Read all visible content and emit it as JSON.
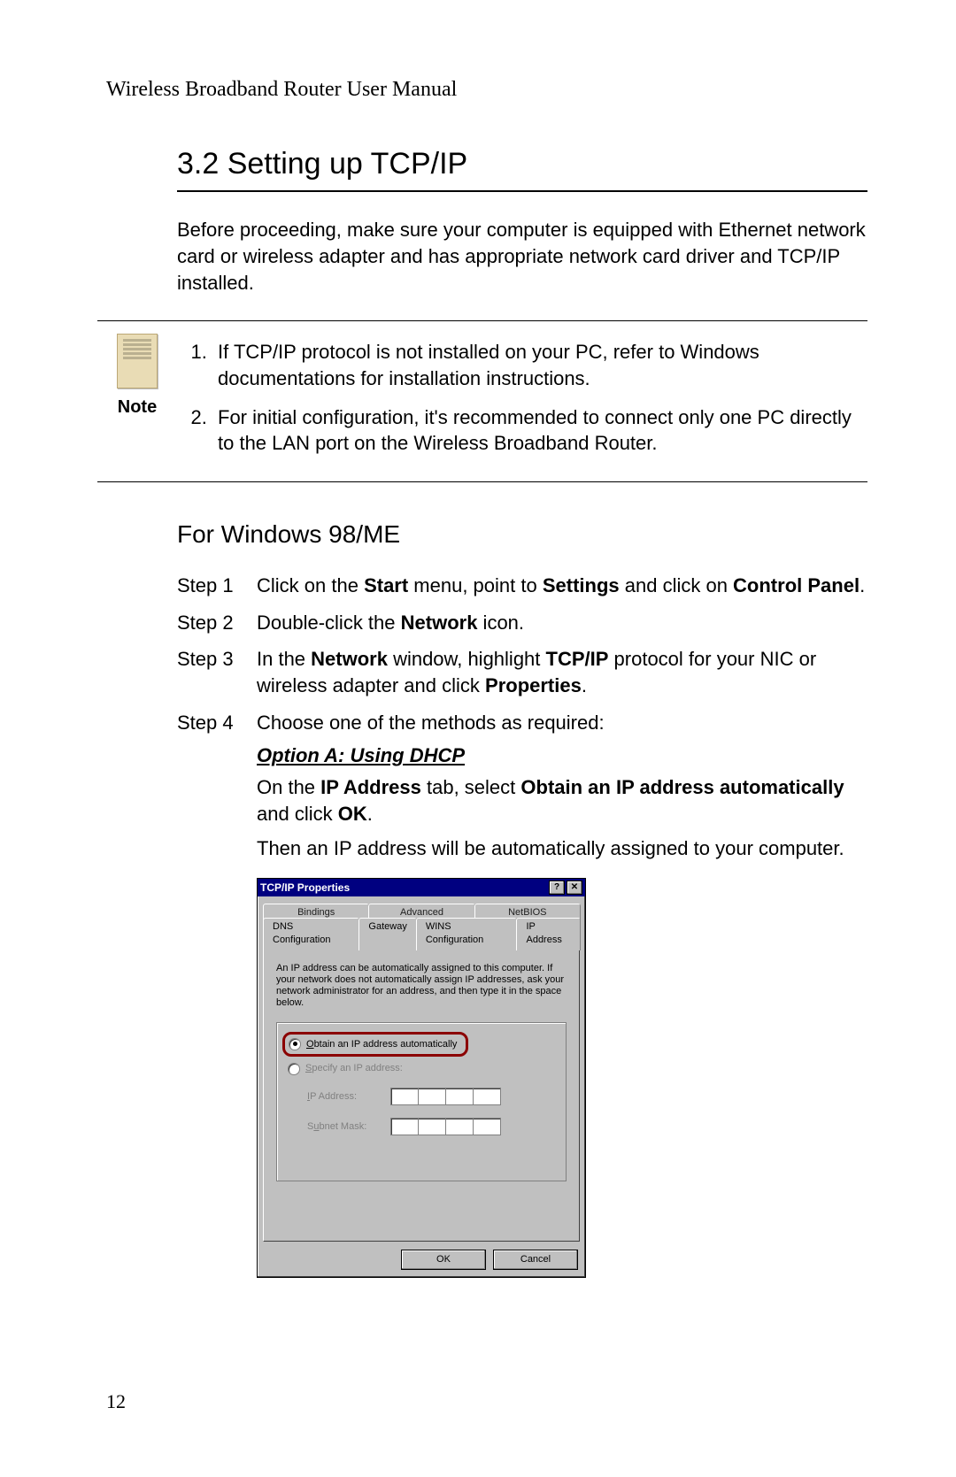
{
  "header": {
    "running_title": "Wireless Broadband Router User Manual"
  },
  "section": {
    "number_title": "3.2 Setting up TCP/IP",
    "intro": "Before proceeding, make sure your computer is equipped with Ethernet network card or wireless adapter and has appropriate network card driver and TCP/IP installed."
  },
  "note": {
    "label": "Note",
    "items": [
      "If TCP/IP protocol is not installed on your PC, refer to Windows documentations for installation instructions.",
      "For initial configuration, it's recommended to connect only one PC directly to the LAN port on the Wireless Broadband Router."
    ]
  },
  "subsection": {
    "title": "For Windows 98/ME"
  },
  "steps": {
    "s1_label": "Step 1",
    "s1_a": "Click on the ",
    "s1_b": "Start",
    "s1_c": " menu, point to ",
    "s1_d": "Settings",
    "s1_e": " and click on ",
    "s1_f": "Control Panel",
    "s1_g": ".",
    "s2_label": "Step 2",
    "s2_a": "Double-click the ",
    "s2_b": "Network",
    "s2_c": " icon.",
    "s3_label": "Step 3",
    "s3_a": "In the ",
    "s3_b": "Network",
    "s3_c": " window, highlight ",
    "s3_d": "TCP/IP",
    "s3_e": " protocol for your NIC or wireless adapter and click ",
    "s3_f": "Properties",
    "s3_g": ".",
    "s4_label": "Step 4",
    "s4_a": "Choose one of the methods as required:"
  },
  "option": {
    "title": "Option A: Using DHCP",
    "p1_a": "On the ",
    "p1_b": "IP Address",
    "p1_c": " tab, select ",
    "p1_d": "Obtain an IP address automatically",
    "p1_e": " and click ",
    "p1_f": "OK",
    "p1_g": ".",
    "p2": "Then an IP address will be automatically assigned to your computer."
  },
  "dialog": {
    "title": "TCP/IP Properties",
    "help_glyph": "?",
    "close_glyph": "✕",
    "tabs_back": [
      "Bindings",
      "Advanced",
      "NetBIOS"
    ],
    "tabs_front": [
      "DNS Configuration",
      "Gateway",
      "WINS Configuration",
      "IP Address"
    ],
    "desc": "An IP address can be automatically assigned to this computer. If your network does not automatically assign IP addresses, ask your network administrator for an address, and then type it in the space below.",
    "radio_auto_pre": "O",
    "radio_auto": "btain an IP address automatically",
    "radio_spec_pre": "S",
    "radio_spec": "pecify an IP address:",
    "ip_pre": "I",
    "ip_label": "P Address:",
    "subnet_pre": "u",
    "subnet_label_pre": "S",
    "subnet_label_post": "bnet Mask:",
    "ok": "OK",
    "cancel": "Cancel"
  },
  "page_number": "12"
}
